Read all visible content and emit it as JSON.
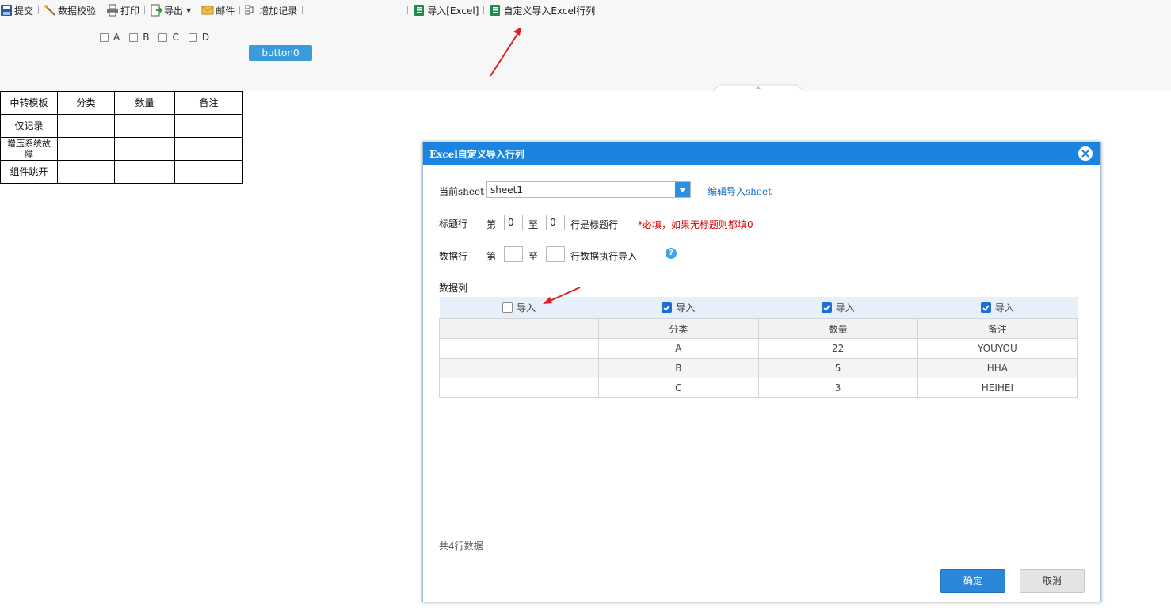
{
  "toolbar": {
    "submit": "提交",
    "validate": "数据校验",
    "print": "打印",
    "export": "导出",
    "mail": "邮件",
    "add_record": "增加记录",
    "import_excel": "导入[Excel]",
    "custom_import": "自定义导入Excel行列"
  },
  "filters": [
    "A",
    "B",
    "C",
    "D"
  ],
  "button0": "button0",
  "report": {
    "header": [
      "中转模板",
      "分类",
      "数量",
      "备注"
    ],
    "rows": [
      [
        "仅记录",
        "",
        "",
        ""
      ],
      [
        "增压系统故障",
        "",
        "",
        ""
      ],
      [
        "组件跳开",
        "",
        "",
        ""
      ]
    ]
  },
  "dialog": {
    "title": "Excel自定义导入行列",
    "sheet_label": "当前sheet",
    "sheet_value": "sheet1",
    "edit_sheet_link": "编辑导入sheet",
    "title_row": {
      "label": "标题行",
      "prefix": "第",
      "from": "0",
      "to_word": "至",
      "to": "0",
      "suffix": "行是标题行",
      "required_note": "*必填，如果无标题则都填0"
    },
    "data_row": {
      "label": "数据行",
      "prefix": "第",
      "from": "",
      "to_word": "至",
      "to": "",
      "suffix": "行数据执行导入",
      "help": "?"
    },
    "columns_label": "数据列",
    "import_label": "导入",
    "import_checked": [
      false,
      true,
      true,
      true
    ],
    "table_header": [
      "",
      "分类",
      "数量",
      "备注"
    ],
    "table_rows": [
      [
        "",
        "A",
        "22",
        "YOUYOU"
      ],
      [
        "",
        "B",
        "5",
        "HHA"
      ],
      [
        "",
        "C",
        "3",
        "HEIHEI"
      ]
    ],
    "total": "共4行数据",
    "ok": "确定",
    "cancel": "取消"
  },
  "colors": {
    "dialog_header": "#1a84e0",
    "ok_button": "#2a86d8",
    "required_text": "#d40000",
    "annotation_arrow": "#e02020"
  }
}
